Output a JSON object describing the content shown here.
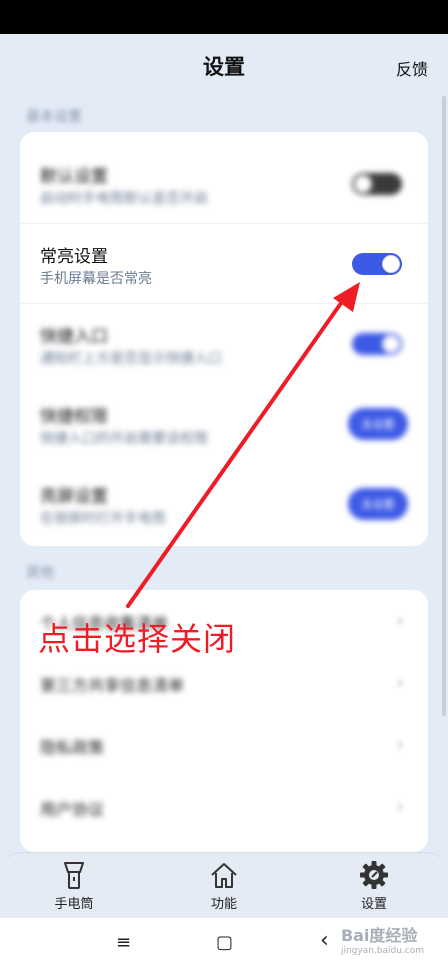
{
  "header": {
    "title": "设置",
    "feedback_label": "反馈"
  },
  "sections": {
    "basic_label": "基本设置",
    "other_label": "其他"
  },
  "settings": [
    {
      "title": "默认设置",
      "subtitle": "启动时手电筒默认是否开启",
      "control": "toggle",
      "state": "off"
    },
    {
      "title": "常亮设置",
      "subtitle": "手机屏幕是否常亮",
      "control": "toggle",
      "state": "on"
    },
    {
      "title": "快捷入口",
      "subtitle": "通知栏上方是否显示快捷入口",
      "control": "toggle",
      "state": "on"
    },
    {
      "title": "快捷权限",
      "subtitle": "快捷入口的开启需要该权限",
      "control": "button",
      "button_label": "去设置"
    },
    {
      "title": "亮屏设置",
      "subtitle": "在锁屏时打开手电筒",
      "control": "button",
      "button_label": "去设置"
    }
  ],
  "other_items": [
    {
      "title": "个人信息收集清单"
    },
    {
      "title": "第三方共享信息清单"
    },
    {
      "title": "隐私政策"
    },
    {
      "title": "用户协议"
    }
  ],
  "annotation": {
    "text": "点击选择关闭",
    "color": "#ee1c25"
  },
  "tabs": [
    {
      "label": "手电筒",
      "icon": "flashlight-icon"
    },
    {
      "label": "功能",
      "icon": "home-icon"
    },
    {
      "label": "设置",
      "icon": "gear-icon",
      "active": true
    }
  ],
  "nav": {
    "menu_glyph": "≡",
    "home_glyph": "▢",
    "back_glyph": "‹"
  },
  "watermark": {
    "text": "Bai度经验",
    "sub": "jingyan.baidu.com"
  },
  "colors": {
    "accent": "#3d5ae6",
    "background": "#e3ebf6",
    "annotation": "#ee1c25"
  }
}
